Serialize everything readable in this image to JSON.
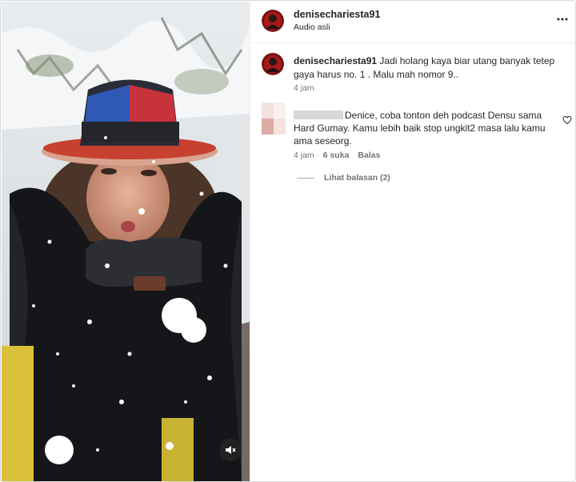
{
  "post": {
    "author_username": "denisechariesta91",
    "audio_label": "Audio asli"
  },
  "caption": {
    "username": "denisechariesta91",
    "text": "Jadi holang kaya biar utang banyak tetep gaya harus no. 1 . Malu mah nomor 9..",
    "time": "4 jam"
  },
  "comment": {
    "text": "Denice, coba tonton deh podcast Densu sama Hard Gumay. Kamu lebih baik stop ungkit2 masa lalu kamu ama seseorg.",
    "time": "4 jam",
    "likes": "6 suka",
    "reply_label": "Balas"
  },
  "replies": {
    "view_label": "Lihat balasan (2)"
  },
  "icons": {
    "more": "more-horizontal-icon",
    "like": "heart-outline-icon",
    "mute": "speaker-muted-icon"
  },
  "colors": {
    "text_primary": "#262626",
    "text_secondary": "#737373",
    "border": "#dbdbdb"
  }
}
